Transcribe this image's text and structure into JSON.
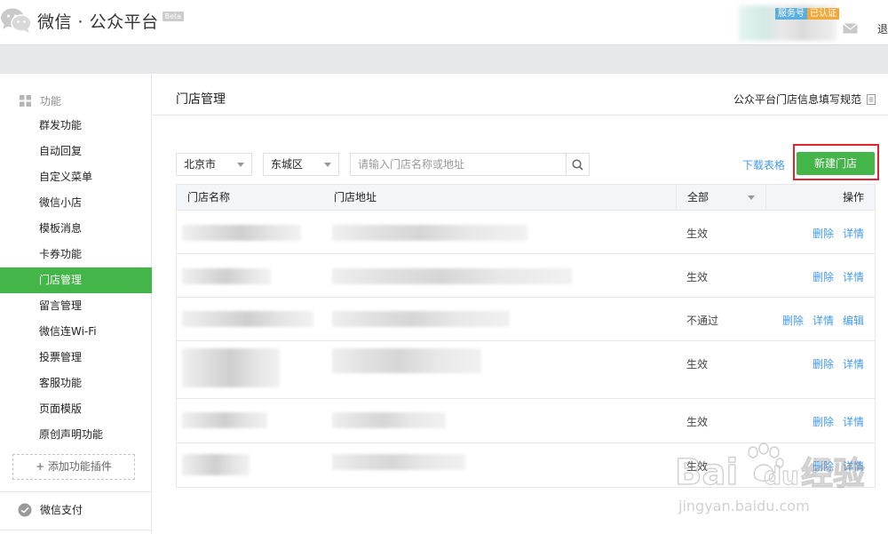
{
  "app": {
    "title": "微信 · 公众平台",
    "beta": "Beta"
  },
  "header": {
    "badge_service": "服务号",
    "badge_verified": "已认证",
    "logout": "退"
  },
  "sidebar": {
    "section_label": "功能",
    "items": [
      {
        "label": "群发功能"
      },
      {
        "label": "自动回复"
      },
      {
        "label": "自定义菜单"
      },
      {
        "label": "微信小店"
      },
      {
        "label": "模板消息"
      },
      {
        "label": "卡券功能"
      },
      {
        "label": "门店管理",
        "active": true
      },
      {
        "label": "留言管理"
      },
      {
        "label": "微信连Wi-Fi"
      },
      {
        "label": "投票管理"
      },
      {
        "label": "客服功能"
      },
      {
        "label": "页面模版"
      },
      {
        "label": "原创声明功能"
      }
    ],
    "add_plugin": "+ 添加功能插件",
    "pay_label": "微信支付"
  },
  "main": {
    "title": "门店管理",
    "spec_link": "公众平台门店信息填写规范",
    "filters": {
      "city": "北京市",
      "district": "东城区",
      "search_placeholder": "请输入门店名称或地址"
    },
    "download_link": "下载表格",
    "new_store": "新建门店",
    "table": {
      "headers": {
        "name": "门店名称",
        "address": "门店地址",
        "status": "全部",
        "ops": "操作"
      },
      "rows": [
        {
          "status": "生效",
          "ops": [
            "删除",
            "详情"
          ]
        },
        {
          "status": "生效",
          "ops": [
            "删除",
            "详情"
          ]
        },
        {
          "status": "不通过",
          "ops": [
            "删除",
            "详情",
            "编辑"
          ]
        },
        {
          "status": "生效",
          "ops": [
            "删除",
            "详情"
          ]
        },
        {
          "status": "生效",
          "ops": [
            "删除",
            "详情"
          ]
        },
        {
          "status": "生效",
          "ops": [
            "删除",
            "详情"
          ]
        }
      ]
    }
  },
  "watermark": {
    "brand": "Bai",
    "brand2": "du",
    "cn": "经验",
    "url": "jingyan.baidu.com"
  },
  "colors": {
    "accent_green": "#44b549",
    "link_blue": "#459ae9",
    "highlight_red": "#e0262c"
  }
}
